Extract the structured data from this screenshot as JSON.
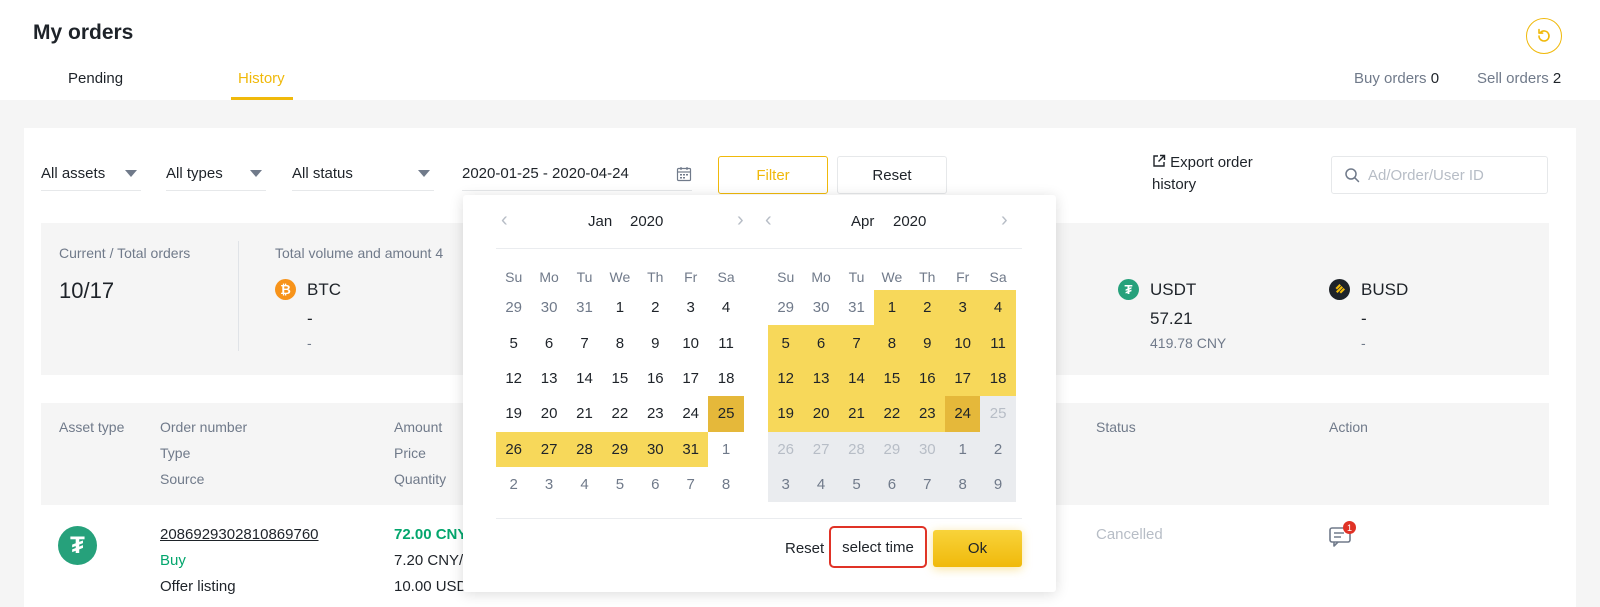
{
  "header": {
    "title": "My orders",
    "tabs": [
      "Pending",
      "History"
    ],
    "active_tab": "History",
    "buy_orders_label": "Buy orders",
    "buy_orders_count": "0",
    "sell_orders_label": "Sell orders",
    "sell_orders_count": "2"
  },
  "filters": {
    "assets": "All assets",
    "types": "All types",
    "status": "All status",
    "date_range": "2020-01-25 - 2020-04-24",
    "filter_label": "Filter",
    "reset_label": "Reset",
    "export_line1": "Export order",
    "export_line2": "history",
    "search_placeholder": "Ad/Order/User ID"
  },
  "summary": {
    "orders_label": "Current / Total orders",
    "orders_value": "10/17",
    "volume_label": "Total volume and amount",
    "volume_trailing": "4",
    "assets": [
      {
        "name": "BTC",
        "value": "-",
        "cny": "-",
        "color": "#f7931a",
        "icon": "bitcoin-icon"
      },
      {
        "name": "USDT",
        "value": "57.21",
        "cny": "419.78 CNY",
        "color": "#26a17b",
        "icon": "tether-icon"
      },
      {
        "name": "BUSD",
        "value": "-",
        "cny": "-",
        "color": "#1e2329",
        "icon": "busd-icon"
      }
    ]
  },
  "table": {
    "headers": {
      "asset_type": "Asset type",
      "order_number": "Order number",
      "type": "Type",
      "source": "Source",
      "amount": "Amount",
      "price": "Price",
      "quantity": "Quantity",
      "status": "Status",
      "action": "Action"
    },
    "rows": [
      {
        "order_number": "2086929302810869760",
        "type": "Buy",
        "source": "Offer listing",
        "amount": "72.00 CNY",
        "price": "7.20 CNY/",
        "quantity": "10.00 USD",
        "status": "Cancelled",
        "chat_badge": "1"
      }
    ]
  },
  "calendar": {
    "left_month": "Jan",
    "left_year": "2020",
    "right_month": "Apr",
    "right_year": "2020",
    "weekdays": [
      "Su",
      "Mo",
      "Tu",
      "We",
      "Th",
      "Fr",
      "Sa"
    ],
    "left_days": [
      [
        "29",
        "m"
      ],
      [
        "30",
        "m"
      ],
      [
        "31",
        "m"
      ],
      [
        "1",
        ""
      ],
      [
        "2",
        ""
      ],
      [
        "3",
        ""
      ],
      [
        "4",
        ""
      ],
      [
        "5",
        ""
      ],
      [
        "6",
        ""
      ],
      [
        "7",
        ""
      ],
      [
        "8",
        ""
      ],
      [
        "9",
        ""
      ],
      [
        "10",
        ""
      ],
      [
        "11",
        ""
      ],
      [
        "12",
        ""
      ],
      [
        "13",
        ""
      ],
      [
        "14",
        ""
      ],
      [
        "15",
        ""
      ],
      [
        "16",
        ""
      ],
      [
        "17",
        ""
      ],
      [
        "18",
        ""
      ],
      [
        "19",
        ""
      ],
      [
        "20",
        ""
      ],
      [
        "21",
        ""
      ],
      [
        "22",
        ""
      ],
      [
        "23",
        ""
      ],
      [
        "24",
        ""
      ],
      [
        "25",
        "e"
      ],
      [
        "26",
        "r"
      ],
      [
        "27",
        "r"
      ],
      [
        "28",
        "r"
      ],
      [
        "29",
        "r"
      ],
      [
        "30",
        "r"
      ],
      [
        "31",
        "r"
      ],
      [
        "1",
        "m"
      ],
      [
        "2",
        "m"
      ],
      [
        "3",
        "m"
      ],
      [
        "4",
        "m"
      ],
      [
        "5",
        "m"
      ],
      [
        "6",
        "m"
      ],
      [
        "7",
        "m"
      ],
      [
        "8",
        "m"
      ]
    ],
    "right_days": [
      [
        "29",
        "m"
      ],
      [
        "30",
        "m"
      ],
      [
        "31",
        "m"
      ],
      [
        "1",
        "r"
      ],
      [
        "2",
        "r"
      ],
      [
        "3",
        "r"
      ],
      [
        "4",
        "r"
      ],
      [
        "5",
        "r"
      ],
      [
        "6",
        "r"
      ],
      [
        "7",
        "r"
      ],
      [
        "8",
        "r"
      ],
      [
        "9",
        "r"
      ],
      [
        "10",
        "r"
      ],
      [
        "11",
        "r"
      ],
      [
        "12",
        "r"
      ],
      [
        "13",
        "r"
      ],
      [
        "14",
        "r"
      ],
      [
        "15",
        "r"
      ],
      [
        "16",
        "r"
      ],
      [
        "17",
        "r"
      ],
      [
        "18",
        "r"
      ],
      [
        "19",
        "r"
      ],
      [
        "20",
        "r"
      ],
      [
        "21",
        "r"
      ],
      [
        "22",
        "r"
      ],
      [
        "23",
        "r"
      ],
      [
        "24",
        "e"
      ],
      [
        "25",
        "df"
      ],
      [
        "26",
        "df"
      ],
      [
        "27",
        "df"
      ],
      [
        "28",
        "df"
      ],
      [
        "29",
        "df"
      ],
      [
        "30",
        "df"
      ],
      [
        "1",
        "d"
      ],
      [
        "2",
        "d"
      ],
      [
        "3",
        "d"
      ],
      [
        "4",
        "d"
      ],
      [
        "5",
        "d"
      ],
      [
        "6",
        "d"
      ],
      [
        "7",
        "d"
      ],
      [
        "8",
        "d"
      ],
      [
        "9",
        "d"
      ]
    ],
    "reset_label": "Reset",
    "select_time_label": "select time",
    "ok_label": "Ok"
  }
}
